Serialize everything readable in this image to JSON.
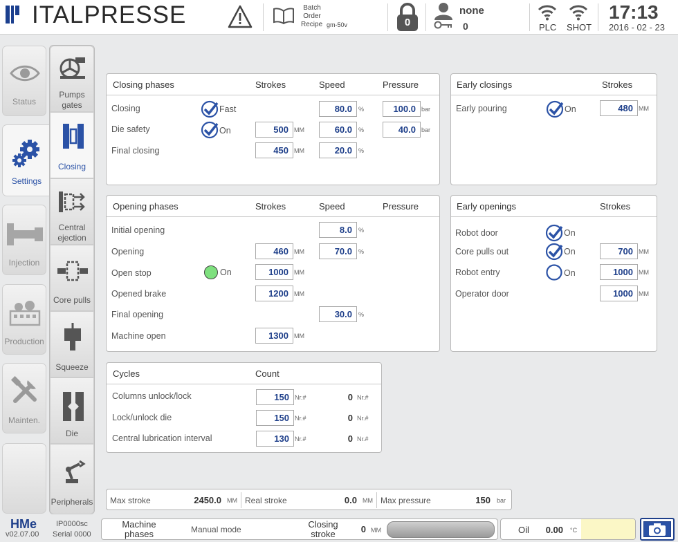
{
  "header": {
    "brand": "ITALPRESSE",
    "batch": {
      "l1": "Batch",
      "l2": "Order",
      "l3": "Recipe",
      "recipe": "gm-50v"
    },
    "lock_count": "0",
    "user": {
      "name": "none",
      "count": "0"
    },
    "plc_label": "PLC",
    "shot_label": "SHOT",
    "time": "17:13",
    "date": "2016 - 02 - 23"
  },
  "sidebar": [
    {
      "label": "Status"
    },
    {
      "label": "Settings"
    },
    {
      "label": "Injection"
    },
    {
      "label": "Production"
    },
    {
      "label": "Mainten."
    },
    {
      "label": ""
    }
  ],
  "subtabs": [
    {
      "l1": "Pumps",
      "l2": "gates"
    },
    {
      "l1": "Closing",
      "l2": ""
    },
    {
      "l1": "Central",
      "l2": "ejection"
    },
    {
      "l1": "Core pulls",
      "l2": ""
    },
    {
      "l1": "Squeeze",
      "l2": ""
    },
    {
      "l1": "Die",
      "l2": ""
    },
    {
      "l1": "Peripherals",
      "l2": ""
    }
  ],
  "closing": {
    "title": "Closing phases",
    "h_strokes": "Strokes",
    "h_speed": "Speed",
    "h_pressure": "Pressure",
    "rows": [
      {
        "label": "Closing",
        "check_label": "Fast",
        "speed": "80.0",
        "pressure": "100.0"
      },
      {
        "label": "Die safety",
        "check_label": "On",
        "strokes": "500",
        "speed": "60.0",
        "pressure": "40.0"
      },
      {
        "label": "Final closing",
        "strokes": "450",
        "speed": "20.0"
      }
    ]
  },
  "early_closings": {
    "title": "Early closings",
    "h_strokes": "Strokes",
    "rows": [
      {
        "label": "Early pouring",
        "check_label": "On",
        "strokes": "480"
      }
    ]
  },
  "opening": {
    "title": "Opening phases",
    "h_strokes": "Strokes",
    "h_speed": "Speed",
    "h_pressure": "Pressure",
    "rows": [
      {
        "label": "Initial opening",
        "speed": "8.0"
      },
      {
        "label": "Opening",
        "strokes": "460",
        "speed": "70.0"
      },
      {
        "label": "Open stop",
        "indicator_label": "On",
        "strokes": "1000"
      },
      {
        "label": "Opened brake",
        "strokes": "1200"
      },
      {
        "label": "Final opening",
        "speed": "30.0"
      },
      {
        "label": "Machine open",
        "strokes": "1300"
      }
    ]
  },
  "early_openings": {
    "title": "Early openings",
    "h_strokes": "Strokes",
    "rows": [
      {
        "label": "Robot door",
        "check_label": "On"
      },
      {
        "label": "Core pulls out",
        "check_label": "On",
        "strokes": "700"
      },
      {
        "label": "Robot entry",
        "check_label": "On",
        "strokes": "1000"
      },
      {
        "label": "Operator door",
        "strokes": "1000"
      }
    ]
  },
  "cycles": {
    "title": "Cycles",
    "h_count": "Count",
    "rows": [
      {
        "label": "Columns unlock/lock",
        "set": "150",
        "count": "0"
      },
      {
        "label": "Lock/unlock die",
        "set": "150",
        "count": "0"
      },
      {
        "label": "Central lubrication interval",
        "set": "130",
        "count": "0"
      }
    ]
  },
  "units": {
    "mm": "MM",
    "pct": "%",
    "bar": "bar",
    "nr": "Nr.#",
    "deg": "°C"
  },
  "stroke_bar": {
    "max_label": "Max stroke",
    "max_value": "2450.0",
    "real_label": "Real stroke",
    "real_value": "0.0",
    "pres_label": "Max pressure",
    "pres_value": "150"
  },
  "footer": {
    "hme": "HMe",
    "version": "v02.07.00",
    "ip": "IP0000sc",
    "serial": "Serial 0000",
    "phase_l1": "Machine",
    "phase_l2": "phases",
    "mode": "Manual mode",
    "cs_l1": "Closing",
    "cs_l2": "stroke",
    "cs_value": "0",
    "oil_label": "Oil",
    "oil_value": "0.00"
  },
  "colors": {
    "accent": "#1e3f8a",
    "brand": "#1b3f8e",
    "indicator_on": "#7ee07e",
    "oil_box": "#fbf7c6"
  }
}
